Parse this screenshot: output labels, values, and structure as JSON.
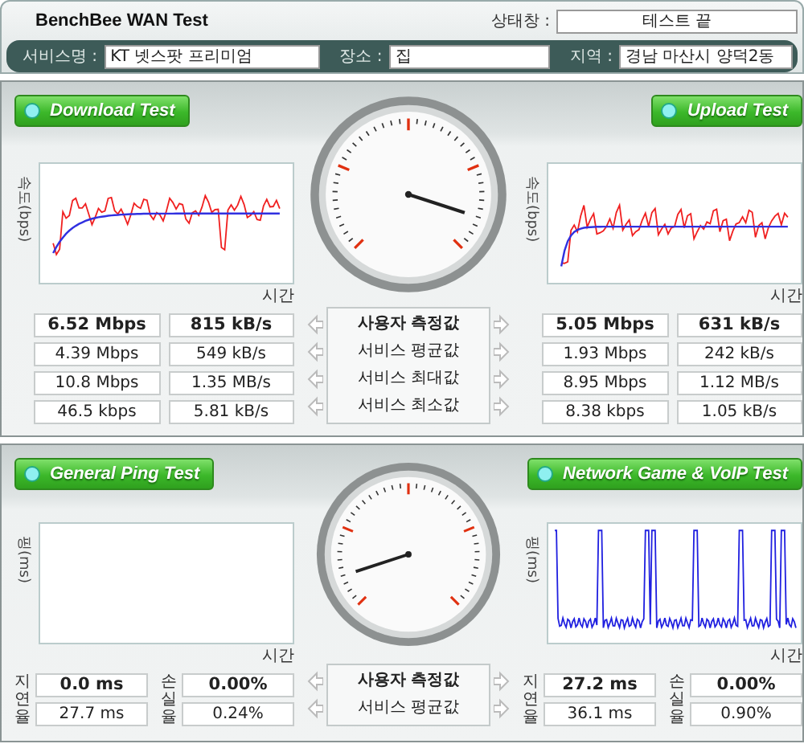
{
  "window": {
    "title": "BenchBee WAN Test"
  },
  "status": {
    "label": "상태창 :",
    "value": "테스트 끝"
  },
  "info": [
    {
      "label": "서비스명 :",
      "value": "KT 넷스팟 프리미엄"
    },
    {
      "label": "장소 :",
      "value": "집"
    },
    {
      "label": "지역 :",
      "value": "경남 마산시 양덕2동"
    }
  ],
  "panels": [
    {
      "kind": "speed",
      "left_button": "Download Test",
      "right_button": "Upload Test",
      "charts": [
        {
          "kind": "download",
          "y_label": "속도(bps)",
          "x_label": "시간"
        },
        {
          "kind": "upload",
          "y_label": "속도(bps)",
          "x_label": "시간"
        }
      ],
      "row_labels": [
        "사용자 측정값",
        "서비스 평균값",
        "서비스 최대값",
        "서비스 최소값"
      ],
      "left_rows": [
        [
          "6.52 Mbps",
          "815 kB/s"
        ],
        [
          "4.39 Mbps",
          "549 kB/s"
        ],
        [
          "10.8 Mbps",
          "1.35 MB/s"
        ],
        [
          "46.5 kbps",
          "5.81 kB/s"
        ]
      ],
      "right_rows": [
        [
          "5.05 Mbps",
          "631 kB/s"
        ],
        [
          "1.93 Mbps",
          "242 kB/s"
        ],
        [
          "8.95 Mbps",
          "1.12 MB/s"
        ],
        [
          "8.38 kbps",
          "1.05 kB/s"
        ]
      ]
    },
    {
      "kind": "ping",
      "left_button": "General Ping Test",
      "right_button": "Network Game & VoIP Test",
      "charts": [
        {
          "kind": "empty",
          "y_label": "핑(ms)",
          "x_label": "시간"
        },
        {
          "kind": "spikes",
          "y_label": "핑(ms)",
          "x_label": "시간"
        }
      ],
      "left_metric_labels": [
        "지연율",
        "손실율"
      ],
      "right_metric_labels": [
        "지연율",
        "손실율"
      ],
      "row_labels": [
        "사용자 측정값",
        "서비스 평균값"
      ],
      "left_rows": [
        [
          "0.0 ms",
          "0.00%"
        ],
        [
          "27.7 ms",
          "0.24%"
        ]
      ],
      "right_rows": [
        [
          "27.2 ms",
          "0.00%"
        ],
        [
          "36.1 ms",
          "0.90%"
        ]
      ]
    }
  ]
}
